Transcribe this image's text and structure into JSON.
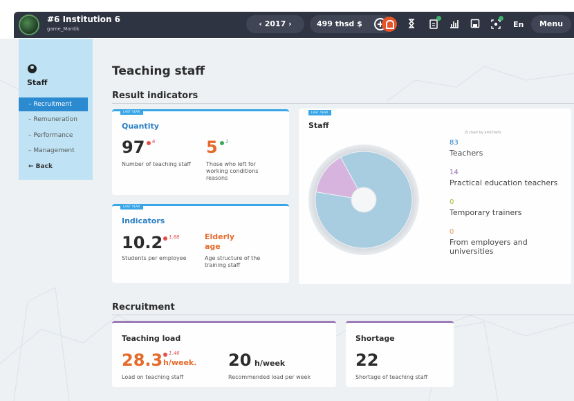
{
  "header": {
    "institution_name": "#6 Institution 6",
    "user": "game_Montik",
    "year": "‹ 2017 ›",
    "budget": "499 thsd $",
    "language": "En",
    "menu_label": "Menu",
    "icons": [
      "avatar",
      "plus-icon",
      "bell-icon",
      "hourglass-icon",
      "document-icon",
      "bar-chart-icon",
      "save-icon",
      "scan-icon"
    ]
  },
  "sidebar": {
    "title": "Staff",
    "items": [
      {
        "label": "– Recruitment",
        "active": true
      },
      {
        "label": "– Remuneration"
      },
      {
        "label": "– Performance"
      },
      {
        "label": "– Management"
      }
    ],
    "back_label": "← Back"
  },
  "page": {
    "title": "Teaching staff",
    "result_indicators_title": "Result indicators",
    "recruitment_title": "Recruitment"
  },
  "quantity_card": {
    "tag": "LAST YEAR",
    "title": "Quantity",
    "teaching_staff_value": "97",
    "teaching_staff_delta": "6",
    "teaching_staff_desc": "Number of teaching staff",
    "left_value": "5",
    "left_delta": "1",
    "left_desc": "Those who left for working conditions reasons"
  },
  "indicators_card": {
    "tag": "LAST YEAR",
    "title": "Indicators",
    "students_value": "10.2",
    "students_delta": "1.88",
    "students_desc": "Students per employee",
    "age_value": "Elderly age",
    "age_desc": "Age structure of the training staff"
  },
  "staff_card": {
    "tag": "LAST YEAR",
    "title": "Staff",
    "credit": "JS chart by amCharts"
  },
  "chart_data": {
    "type": "pie",
    "title": "Staff",
    "categories": [
      "Teachers",
      "Practical education teachers",
      "Temporary trainers",
      "From employers and universities"
    ],
    "values": [
      83,
      14,
      0,
      0
    ],
    "colors": [
      "#a9cde0",
      "#d7b4de",
      "#e6f0a0",
      "#f3d0a8"
    ],
    "legend_position": "right"
  },
  "teaching_load_card": {
    "title": "Teaching load",
    "load_value": "28.3",
    "load_unit": "h/week.",
    "load_delta": "1.46",
    "load_desc": "Load on teaching staff",
    "recommended_value": "20",
    "recommended_unit": "h/week",
    "recommended_desc": "Recommended load per week"
  },
  "shortage_card": {
    "title": "Shortage",
    "value": "22",
    "desc": "Shortage of teaching staff"
  }
}
